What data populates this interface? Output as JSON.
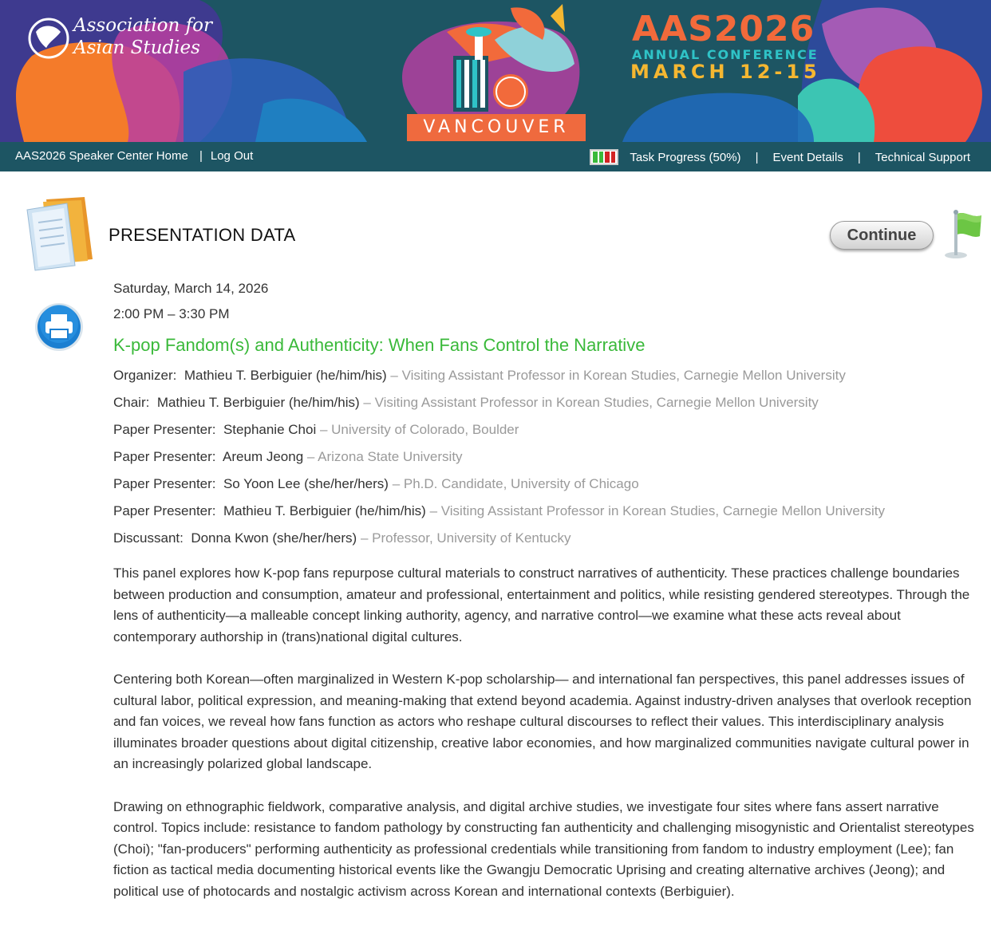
{
  "banner": {
    "org_line1": "Association for",
    "org_line2": "Asian Studies",
    "conference_title": "AAS2026",
    "conference_subtitle": "ANNUAL CONFERENCE",
    "conference_dates": "MARCH 12-15",
    "city": "VANCOUVER"
  },
  "nav": {
    "home_link": "AAS2026 Speaker Center Home",
    "separator": "|",
    "logout_link": "Log Out",
    "task_progress": "Task Progress (50%)",
    "task_progress_value": 0.5,
    "event_details": "Event Details",
    "technical_support": "Technical Support"
  },
  "header": {
    "title": "PRESENTATION DATA",
    "continue_label": "Continue"
  },
  "icons": {
    "folder": "documents-folder-icon",
    "flag": "green-flag-icon",
    "print": "printer-icon"
  },
  "colors": {
    "nav_bg": "#1d5563",
    "title_green": "#3ab93a",
    "affiliation_gray": "#9a9a9a"
  },
  "session": {
    "date": "Saturday, March 14, 2026",
    "time": "2:00 PM – 3:30 PM",
    "title": "K-pop Fandom(s) and Authenticity: When Fans Control the Narrative",
    "participants": [
      {
        "role": "Organizer:",
        "name": "Mathieu T. Berbiguier (he/him/his)",
        "affiliation": "– Visiting Assistant Professor in Korean Studies, Carnegie Mellon University"
      },
      {
        "role": "Chair:",
        "name": "Mathieu T. Berbiguier (he/him/his)",
        "affiliation": "– Visiting Assistant Professor in Korean Studies, Carnegie Mellon University"
      },
      {
        "role": "Paper Presenter:",
        "name": "Stephanie Choi",
        "affiliation": "– University of Colorado, Boulder"
      },
      {
        "role": "Paper Presenter:",
        "name": "Areum Jeong",
        "affiliation": "– Arizona State University"
      },
      {
        "role": "Paper Presenter:",
        "name": "So Yoon Lee (she/her/hers)",
        "affiliation": "– Ph.D. Candidate, University of Chicago"
      },
      {
        "role": "Paper Presenter:",
        "name": "Mathieu T. Berbiguier (he/him/his)",
        "affiliation": "– Visiting Assistant Professor in Korean Studies, Carnegie Mellon University"
      },
      {
        "role": "Discussant:",
        "name": "Donna Kwon (she/her/hers)",
        "affiliation": "– Professor, University of Kentucky"
      }
    ],
    "description": [
      "This panel explores how K-pop fans repurpose cultural materials to construct narratives of authenticity. These practices challenge boundaries between production and consumption, amateur and professional, entertainment and politics, while resisting gendered stereotypes. Through the lens of authenticity—a malleable concept linking authority, agency, and narrative control—we examine what these acts reveal about contemporary authorship in (trans)national digital cultures.",
      "Centering both Korean—often marginalized in Western K-pop scholarship— and international fan perspectives, this panel addresses issues of cultural labor, political expression, and meaning-making that extend beyond academia. Against industry-driven analyses that overlook reception and fan voices, we reveal how fans function as actors  who reshape cultural discourses  to reflect their values. This interdisciplinary analysis illuminates broader questions about digital citizenship, creative labor economies, and how marginalized communities navigate cultural power in an increasingly polarized global landscape.",
      "Drawing on ethnographic fieldwork, comparative analysis, and digital archive studies, we investigate four sites where fans assert narrative control. Topics include: resistance to fandom pathology by constructing fan authenticity and challenging misogynistic and Orientalist stereotypes (Choi); \"fan-producers\" performing authenticity as professional credentials while transitioning from fandom to industry employment (Lee); fan fiction as tactical media documenting historical events like the Gwangju Democratic Uprising and creating alternative archives (Jeong); and political use of photocards and nostalgic activism across Korean and international contexts (Berbiguier)."
    ]
  }
}
